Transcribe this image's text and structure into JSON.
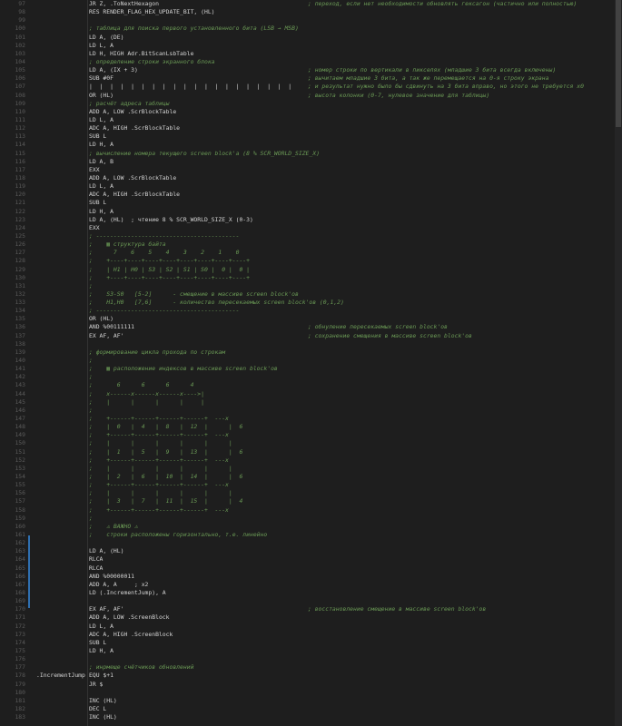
{
  "editor": {
    "lines": [
      {
        "n": "97",
        "label": "",
        "code": "JR Z, .ToNextHexagon",
        "comment": "; переход, если нет необходимости обновлять гексагон (частично или полностью)"
      },
      {
        "n": "98",
        "label": "",
        "code": "RES RENDER_FLAG_HEX_UPDATE_BIT, (HL)",
        "comment": ""
      },
      {
        "n": "99",
        "label": "",
        "code": "",
        "comment": ""
      },
      {
        "n": "100",
        "label": "",
        "code": "; таблица для поиска первого установленного бита (LSB → MSB)",
        "comment": ""
      },
      {
        "n": "101",
        "label": "",
        "code": "LD A, (DE)",
        "comment": ""
      },
      {
        "n": "102",
        "label": "",
        "code": "LD L, A",
        "comment": ""
      },
      {
        "n": "103",
        "label": "",
        "code": "LD H, HIGH Adr.BitScanLsbTable",
        "comment": ""
      },
      {
        "n": "104",
        "label": "",
        "code": "; определение строки экранного блока",
        "comment": ""
      },
      {
        "n": "105",
        "label": "",
        "code": "LD A, (IX + 3)",
        "comment": "; номер строки по вертикали в пикселях (младшие 3 бита всегда включены)"
      },
      {
        "n": "106",
        "label": "",
        "code": "SUB #0F",
        "comment": "; вычитаем младшие 3 бита, а так же перемещается на 0-я строку экрана"
      },
      {
        "n": "107",
        "label": "",
        "code": "|  |  |  |  |  |  |  |  |  |  |  |  |  |  |  |  |  |  |  |",
        "comment": "; и результат нужно было бы сдвинуть на 3 бита вправо, но этого не требуется x0"
      },
      {
        "n": "108",
        "label": "",
        "code": "OR (HL)",
        "comment": "; высота колонки (0-7, нулевое значение для таблицы)"
      },
      {
        "n": "109",
        "label": "",
        "code": "; расчёт адреса таблицы",
        "comment": ""
      },
      {
        "n": "110",
        "label": "",
        "code": "ADD A, LOW .ScrBlockTable",
        "comment": ""
      },
      {
        "n": "111",
        "label": "",
        "code": "LD L, A",
        "comment": ""
      },
      {
        "n": "112",
        "label": "",
        "code": "ADC A, HIGH .ScrBlockTable",
        "comment": ""
      },
      {
        "n": "113",
        "label": "",
        "code": "SUB L",
        "comment": ""
      },
      {
        "n": "114",
        "label": "",
        "code": "LD H, A",
        "comment": ""
      },
      {
        "n": "115",
        "label": "",
        "code": "; вычисление номера текущего screen block'a (8 % SCR_WORLD_SIZE_X)",
        "comment": ""
      },
      {
        "n": "116",
        "label": "",
        "code": "LD A, B",
        "comment": ""
      },
      {
        "n": "117",
        "label": "",
        "code": "EXX",
        "comment": ""
      },
      {
        "n": "118",
        "label": "",
        "code": "ADD A, LOW .ScrBlockTable",
        "comment": ""
      },
      {
        "n": "119",
        "label": "",
        "code": "LD L, A",
        "comment": ""
      },
      {
        "n": "120",
        "label": "",
        "code": "ADC A, HIGH .ScrBlockTable",
        "comment": ""
      },
      {
        "n": "121",
        "label": "",
        "code": "SUB L",
        "comment": ""
      },
      {
        "n": "122",
        "label": "",
        "code": "LD H, A",
        "comment": ""
      },
      {
        "n": "123",
        "label": "",
        "code": "LD A, (HL)  ; чтение 8 % SCR_WORLD_SIZE_X (0-3)",
        "comment": ""
      },
      {
        "n": "124",
        "label": "",
        "code": "EXX",
        "comment": ""
      },
      {
        "n": "125",
        "label": "",
        "code": "; -----------------------------------------",
        "comment": ""
      },
      {
        "n": "126",
        "label": "",
        "code": ";    ▦ структура байта",
        "comment": ""
      },
      {
        "n": "127",
        "label": "",
        "code": ";      7    6    5    4    3    2    1    0",
        "comment": ""
      },
      {
        "n": "128",
        "label": "",
        "code": ";    +----+----+----+----+----+----+----+----+",
        "comment": ""
      },
      {
        "n": "129",
        "label": "",
        "code": ";    | H1 | H0 | S3 | S2 | S1 | S0 |  0 |  0 |",
        "comment": ""
      },
      {
        "n": "130",
        "label": "",
        "code": ";    +----+----+----+----+----+----+----+----+",
        "comment": ""
      },
      {
        "n": "131",
        "label": "",
        "code": ";",
        "comment": ""
      },
      {
        "n": "132",
        "label": "",
        "code": ";    S3-S0   [5-2]      - смещение в массиве screen block'ов",
        "comment": ""
      },
      {
        "n": "133",
        "label": "",
        "code": ";    H1,H0   [7,6]      - количество пересекаемых screen block'ов (0,1,2)",
        "comment": ""
      },
      {
        "n": "134",
        "label": "",
        "code": "; -----------------------------------------",
        "comment": ""
      },
      {
        "n": "135",
        "label": "",
        "code": "OR (HL)",
        "comment": ""
      },
      {
        "n": "136",
        "label": "",
        "code": "AND %00111111",
        "comment": "; обнуление пересекаемых screen block'ов"
      },
      {
        "n": "137",
        "label": "",
        "code": "EX AF, AF'",
        "comment": "; сохранение смещения в массиве screen block'ов"
      },
      {
        "n": "138",
        "label": "",
        "code": "",
        "comment": ""
      },
      {
        "n": "139",
        "label": "",
        "code": "; формирование цикла прохода по строкам",
        "comment": ""
      },
      {
        "n": "140",
        "label": "",
        "code": ";",
        "comment": ""
      },
      {
        "n": "141",
        "label": "",
        "code": ";    ▦ расположение индексов в массиве screen block'ов",
        "comment": ""
      },
      {
        "n": "142",
        "label": "",
        "code": ";",
        "comment": ""
      },
      {
        "n": "143",
        "label": "",
        "code": ";       6      6      6      4",
        "comment": ""
      },
      {
        "n": "144",
        "label": "",
        "code": ";    x------x------x------x---->|",
        "comment": ""
      },
      {
        "n": "145",
        "label": "",
        "code": ";    |      |      |      |     |",
        "comment": ""
      },
      {
        "n": "146",
        "label": "",
        "code": ";",
        "comment": ""
      },
      {
        "n": "147",
        "label": "",
        "code": ";    +------+------+------+------+  ---x",
        "comment": ""
      },
      {
        "n": "148",
        "label": "",
        "code": ";    |  0   |  4   |  8   |  12  |      |  6",
        "comment": ""
      },
      {
        "n": "149",
        "label": "",
        "code": ";    +------+------+------+------+  ---x",
        "comment": ""
      },
      {
        "n": "150",
        "label": "",
        "code": ";    |      |      |      |      |      |",
        "comment": ""
      },
      {
        "n": "151",
        "label": "",
        "code": ";    |  1   |  5   |  9   |  13  |      |  6",
        "comment": ""
      },
      {
        "n": "152",
        "label": "",
        "code": ";    +------+------+------+------+  ---x",
        "comment": ""
      },
      {
        "n": "153",
        "label": "",
        "code": ";    |      |      |      |      |      |",
        "comment": ""
      },
      {
        "n": "154",
        "label": "",
        "code": ";    |  2   |  6   |  10  |  14  |      |  6",
        "comment": ""
      },
      {
        "n": "155",
        "label": "",
        "code": ";    +------+------+------+------+  ---x",
        "comment": ""
      },
      {
        "n": "156",
        "label": "",
        "code": ";    |      |      |      |      |      |",
        "comment": ""
      },
      {
        "n": "157",
        "label": "",
        "code": ";    |  3   |  7   |  11  |  15  |      |  4",
        "comment": ""
      },
      {
        "n": "158",
        "label": "",
        "code": ";    +------+------+------+------+  ---x",
        "comment": ""
      },
      {
        "n": "159",
        "label": "",
        "code": ";",
        "comment": ""
      },
      {
        "n": "160",
        "label": "",
        "code": ";    ⚠ ВАЖНО ⚠",
        "comment": ""
      },
      {
        "n": "161",
        "label": "",
        "code": ";    строки расположены горизонтально, т.е. линейно",
        "comment": ""
      },
      {
        "n": "162",
        "label": "",
        "code": "",
        "comment": ""
      },
      {
        "n": "163",
        "label": "",
        "code": "LD A, (HL)",
        "comment": ""
      },
      {
        "n": "164",
        "label": "",
        "code": "RLCA",
        "comment": ""
      },
      {
        "n": "165",
        "label": "",
        "code": "RLCA",
        "comment": ""
      },
      {
        "n": "166",
        "label": "",
        "code": "AND %00000011",
        "comment": ""
      },
      {
        "n": "167",
        "label": "",
        "code": "ADD A, A     ; x2",
        "comment": ""
      },
      {
        "n": "168",
        "label": "",
        "code": "LD (.IncrementJump), A",
        "comment": ""
      },
      {
        "n": "169",
        "label": "",
        "code": "",
        "comment": ""
      },
      {
        "n": "170",
        "label": "",
        "code": "EX AF, AF'",
        "comment": "; восстановление смещение в массиве screen block'ов"
      },
      {
        "n": "171",
        "label": "",
        "code": "ADD A, LOW .ScreenBlock",
        "comment": ""
      },
      {
        "n": "172",
        "label": "",
        "code": "LD L, A",
        "comment": ""
      },
      {
        "n": "173",
        "label": "",
        "code": "ADC A, HIGH .ScreenBlock",
        "comment": ""
      },
      {
        "n": "174",
        "label": "",
        "code": "SUB L",
        "comment": ""
      },
      {
        "n": "175",
        "label": "",
        "code": "LD H, A",
        "comment": ""
      },
      {
        "n": "176",
        "label": "",
        "code": "",
        "comment": ""
      },
      {
        "n": "177",
        "label": "",
        "code": "; инрмеще счётчиков обновлений",
        "comment": ""
      },
      {
        "n": "178",
        "label": ".IncrementJump",
        "code": "EQU $+1",
        "comment": ""
      },
      {
        "n": "179",
        "label": "",
        "code": "JR $",
        "comment": ""
      },
      {
        "n": "180",
        "label": "",
        "code": "",
        "comment": ""
      },
      {
        "n": "181",
        "label": "",
        "code": "INC (HL)",
        "comment": ""
      },
      {
        "n": "182",
        "label": "",
        "code": "DEC L",
        "comment": ""
      },
      {
        "n": "183",
        "label": "",
        "code": "INC (HL)",
        "comment": ""
      }
    ]
  }
}
